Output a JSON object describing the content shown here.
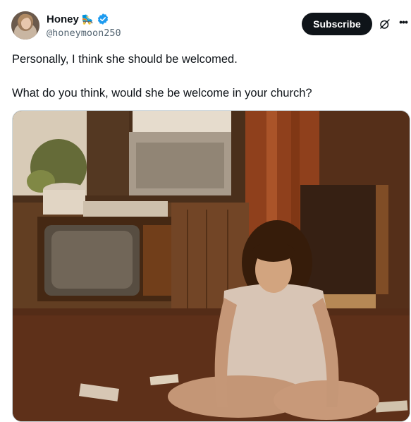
{
  "author": {
    "display_name": "Honey",
    "emoji": "🛼",
    "handle": "@honeymoon250",
    "verified_icon": "verified-badge-icon",
    "avatar_icon": "avatar"
  },
  "actions": {
    "subscribe_label": "Subscribe",
    "grok_icon": "grok-icon",
    "more_icon": "more-options-icon"
  },
  "tweet": {
    "line1": "Personally, I think she should be welcomed.",
    "line2": "What do you think, would she be welcome in your church?"
  },
  "colors": {
    "text": "#0f1419",
    "secondary": "#536471",
    "verified": "#1d9bf0",
    "button_bg": "#0f1419"
  }
}
